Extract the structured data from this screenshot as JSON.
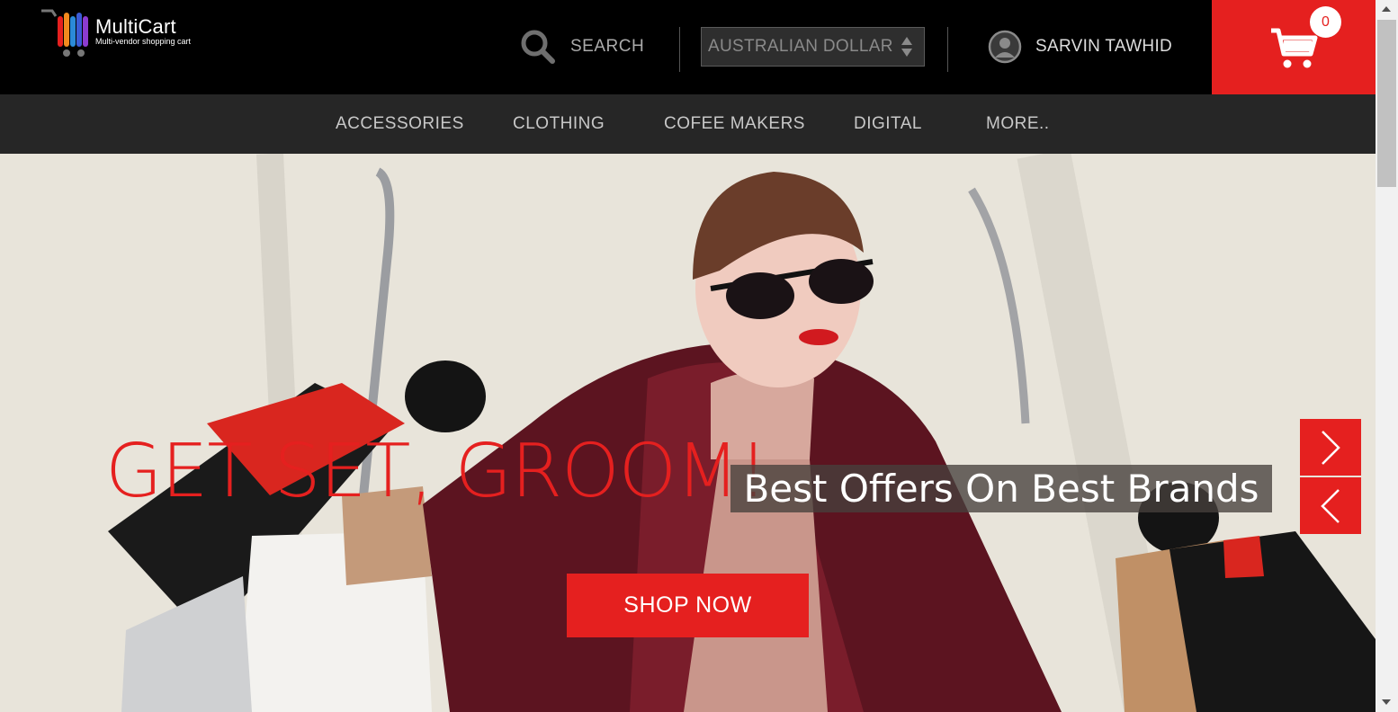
{
  "header": {
    "logo_title": "MultiCart",
    "logo_subtitle": "Multi-vendor shopping cart",
    "search_label": "SEARCH",
    "currency_selected": "AUSTRALIAN DOLLAR",
    "user_name": "SARVIN TAWHID",
    "cart_count": "0"
  },
  "nav": {
    "items": [
      "ACCESSORIES",
      "CLOTHING",
      "COFEE MAKERS",
      "DIGITAL",
      "MORE.."
    ]
  },
  "hero": {
    "headline": "GET SET, GROOM!",
    "subheadline": "Best Offers On Best Brands",
    "cta_label": "SHOP NOW"
  },
  "colors": {
    "accent": "#e5201f",
    "header_bg": "#000000",
    "nav_bg": "#262626"
  },
  "icons": [
    "logo-cart-icon",
    "search-icon",
    "select-arrows-icon",
    "user-avatar-icon",
    "shopping-cart-icon",
    "chevron-right-icon",
    "chevron-left-icon"
  ]
}
